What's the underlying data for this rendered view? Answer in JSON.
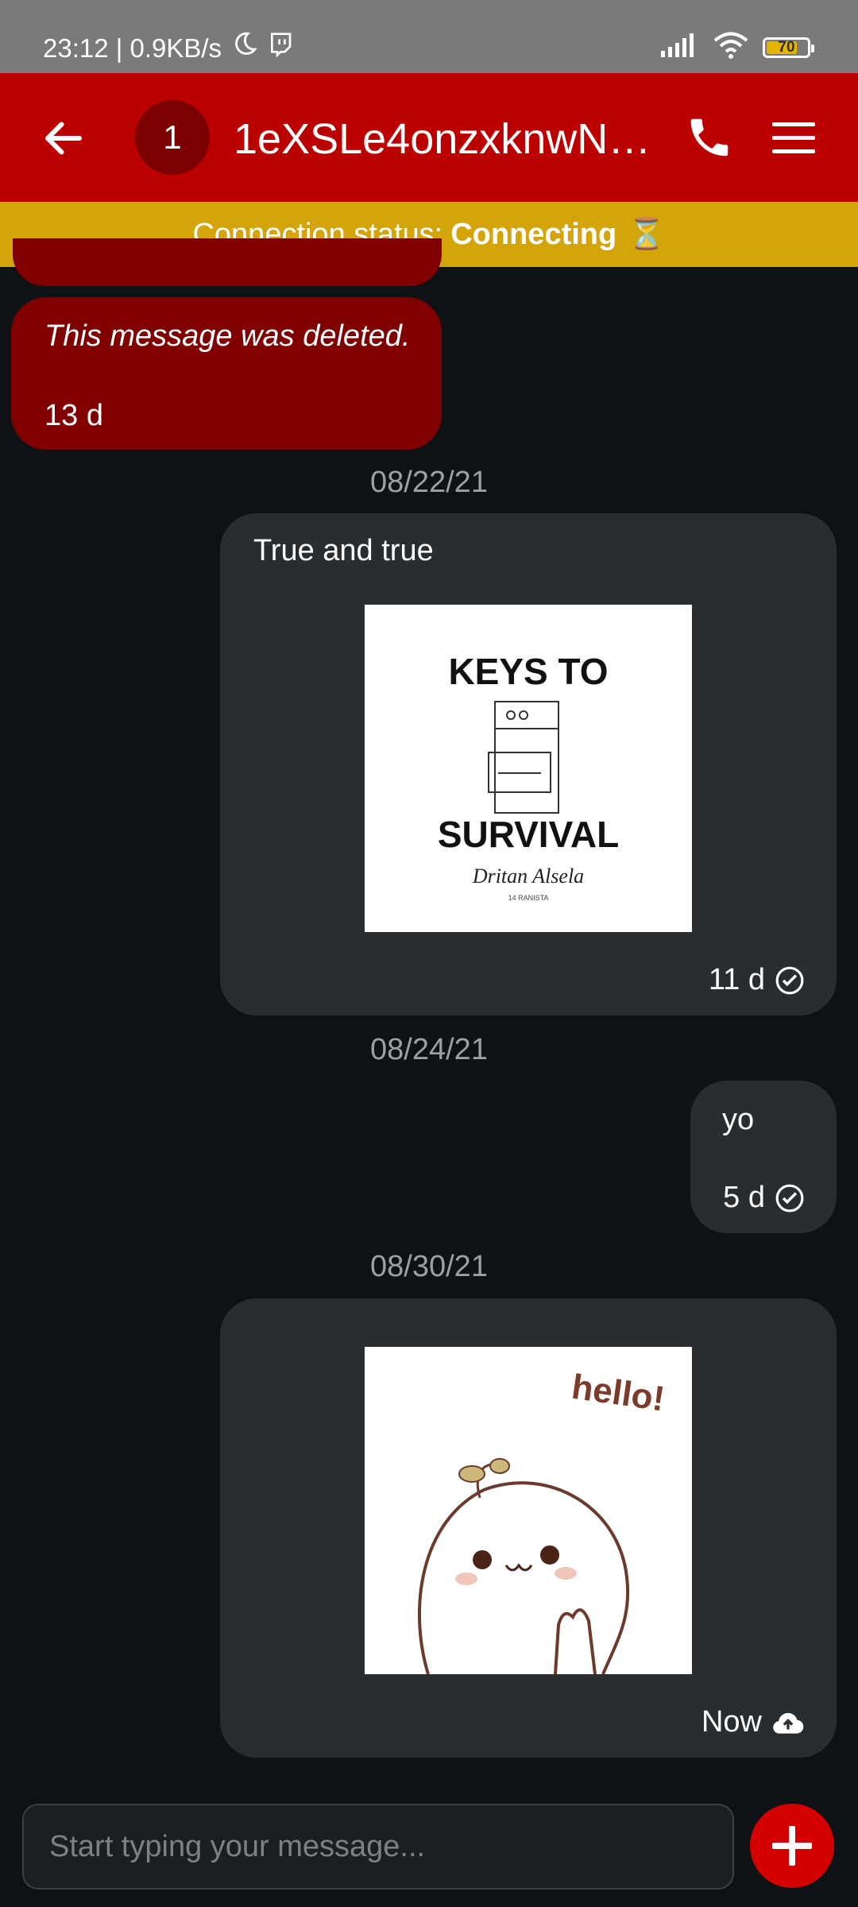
{
  "status_bar": {
    "time_speed": "23:12 | 0.9KB/s",
    "battery_level": "70",
    "icons": [
      "moon-icon",
      "twitch-icon",
      "signal-icon",
      "wifi-icon",
      "battery-icon"
    ]
  },
  "header": {
    "avatar_initial": "1",
    "title": "1eXSLe4onzxknwN…",
    "icons": [
      "back-arrow-icon",
      "phone-icon",
      "hamburger-menu-icon"
    ]
  },
  "connection": {
    "label": "Connection status:",
    "status": "Connecting",
    "emoji": "⏳"
  },
  "messages": {
    "deleted": {
      "text": "This message was deleted.",
      "time": "13 d"
    },
    "date1": "08/22/21",
    "msg1": {
      "text": "True and true",
      "time": "11 d",
      "image_text_top": "KEYS TO",
      "image_text_bottom": "SURVIVAL",
      "image_signature": "Dritan Alsela",
      "image_caption": "14 RANISTA"
    },
    "date2": "08/24/21",
    "msg2": {
      "text": "yo",
      "time": "5 d"
    },
    "date3": "08/30/21",
    "msg3": {
      "time": "Now",
      "image_text": "hello!"
    }
  },
  "composer": {
    "placeholder": "Start typing your message..."
  },
  "colors": {
    "header": "#bb0000",
    "connection_bar": "#d4a50b",
    "incoming_bubble": "#800000",
    "outgoing_bubble": "#2a2d2f",
    "background": "#0f1214",
    "fab": "#d40000"
  }
}
